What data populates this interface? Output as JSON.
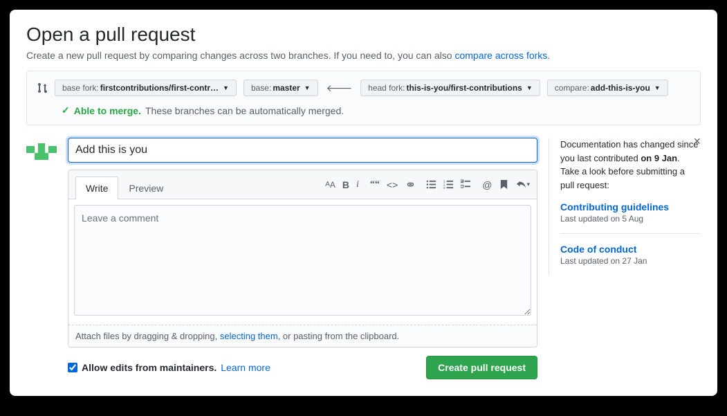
{
  "header": {
    "title": "Open a pull request",
    "subtitle_prefix": "Create a new pull request by comparing changes across two branches. If you need to, you can also ",
    "subtitle_link": "compare across forks",
    "subtitle_suffix": "."
  },
  "compare": {
    "base_fork_label": "base fork: ",
    "base_fork_value": "firstcontributions/first-contr…",
    "base_label": "base: ",
    "base_value": "master",
    "head_fork_label": "head fork: ",
    "head_fork_value": "this-is-you/first-contributions",
    "compare_label": "compare: ",
    "compare_value": "add-this-is-you",
    "merge_check": "✓",
    "merge_able": "Able to merge.",
    "merge_text": "These branches can be automatically merged."
  },
  "form": {
    "title_value": "Add this is you",
    "tab_write": "Write",
    "tab_preview": "Preview",
    "comment_placeholder": "Leave a comment",
    "attach_prefix": "Attach files by dragging & dropping, ",
    "attach_link": "selecting them",
    "attach_suffix": ", or pasting from the clipboard.",
    "allow_edits_label": "Allow edits from maintainers.",
    "learn_more": "Learn more",
    "submit": "Create pull request"
  },
  "sidebar": {
    "notice_prefix": "Documentation has changed since you last contributed ",
    "notice_date": "on 9 Jan",
    "notice_suffix": ". Take a look before submitting a pull request:",
    "link1": "Contributing guidelines",
    "link1_meta": "Last updated on 5 Aug",
    "link2": "Code of conduct",
    "link2_meta": "Last updated on 27 Jan"
  }
}
